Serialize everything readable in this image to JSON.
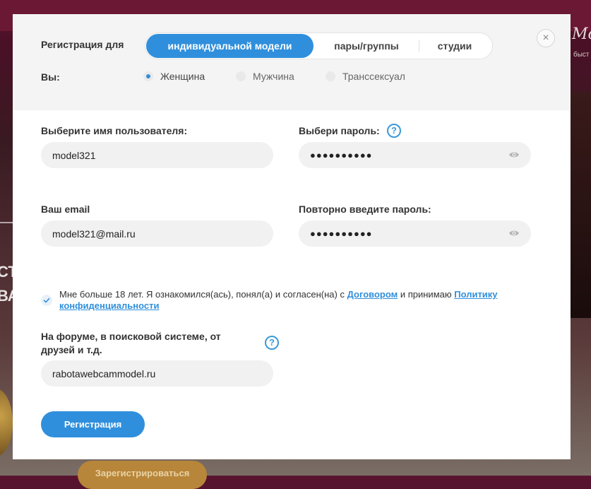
{
  "background": {
    "left_text_1": "СТ",
    "left_text_2": "ВА",
    "logo": "Mod",
    "small_text": "быст",
    "pill_label": "Зарегистрироваться"
  },
  "modal": {
    "close_icon": "×",
    "registration_for_label": "Регистрация для",
    "account_types": [
      {
        "label": "индивидуальной модели",
        "active": true
      },
      {
        "label": "пары/группы",
        "active": false
      },
      {
        "label": "студии",
        "active": false
      }
    ],
    "you_label": "Вы:",
    "genders": [
      {
        "label": "Женщина",
        "selected": true
      },
      {
        "label": "Мужчина",
        "selected": false
      },
      {
        "label": "Транссексуал",
        "selected": false
      }
    ],
    "username": {
      "label": "Выберите имя пользователя:",
      "value": "model321"
    },
    "password": {
      "label": "Выбери пароль:",
      "value": "●●●●●●●●●●",
      "help_icon": "?"
    },
    "email": {
      "label": "Ваш email",
      "value": "model321@mail.ru"
    },
    "password_repeat": {
      "label": "Повторно введите пароль:",
      "value": "●●●●●●●●●●"
    },
    "agreement": {
      "text_before": "Мне больше 18 лет. Я ознакомился(ась), понял(а) и согласен(на) с ",
      "link_contract": "Договором",
      "text_middle": " и принимаю ",
      "link_privacy": "Политику конфиденциальности",
      "checked": true
    },
    "referral": {
      "label": "На форуме, в поисковой системе, от друзей и т.д.",
      "value": "rabotawebcammodel.ru",
      "help_icon": "?"
    },
    "submit_label": "Регистрация"
  },
  "colors": {
    "accent": "#2f8fdc",
    "field_bg": "#f1f1f1",
    "header_bg": "#f4f4f4"
  }
}
